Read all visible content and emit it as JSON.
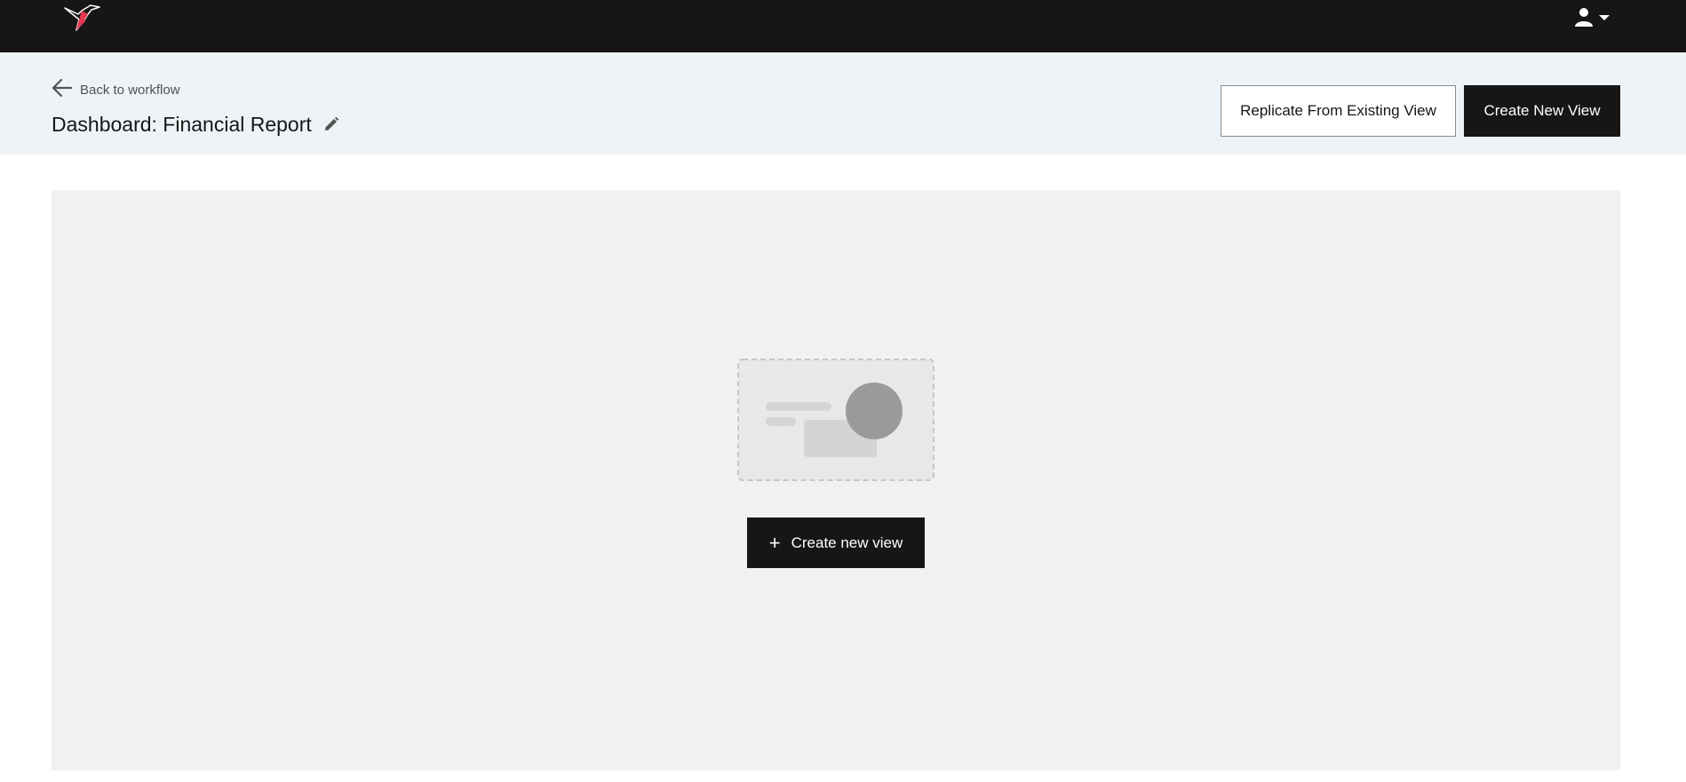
{
  "header": {
    "logo_icon": "hummingbird-logo",
    "user_icon": "user-icon",
    "menu_caret_icon": "caret-down-icon"
  },
  "page_header": {
    "back_label": "Back to workflow",
    "title": "Dashboard: Financial Report",
    "edit_icon": "pencil-icon"
  },
  "actions": {
    "replicate_label": "Replicate From Existing View",
    "create_label": "Create New View"
  },
  "empty_state": {
    "illustration": "empty-view-illustration",
    "create_button_label": "Create new view"
  },
  "colors": {
    "topbar": "#161616",
    "header_bg": "#eef3f7",
    "content_bg": "#f1f1f1",
    "logo_accent": "#e8364f"
  }
}
